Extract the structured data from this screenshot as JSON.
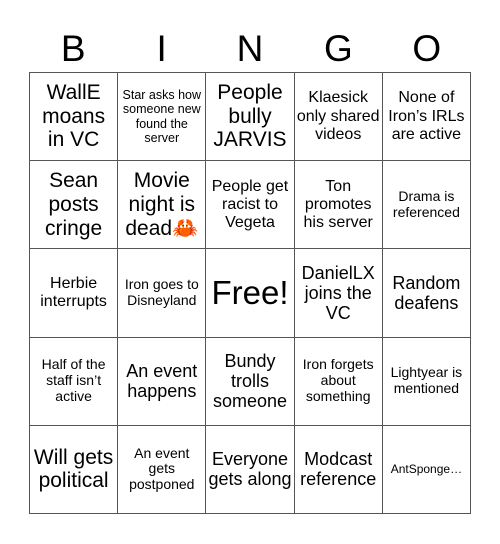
{
  "header": {
    "letters": [
      "B",
      "I",
      "N",
      "G",
      "O"
    ]
  },
  "cells": [
    [
      "WallE moans in VC",
      "Star asks how someone new found the server",
      "People bully JARVIS",
      "Klaesick only shared videos",
      "None of Iron’s IRLs are active"
    ],
    [
      "Sean posts cringe",
      "Movie night is dead🦀",
      "People get racist to Vegeta",
      "Ton promotes his server",
      "Drama is referenced"
    ],
    [
      "Herbie interrupts",
      "Iron goes to Disneyland",
      "Free!",
      "DanielLX joins the VC",
      "Random deafens"
    ],
    [
      "Half of the staff isn’t active",
      "An event happens",
      "Bundy trolls someone",
      "Iron forgets about something",
      "Lightyear is mentioned"
    ],
    [
      "Will gets political",
      "An event gets postponed",
      "Everyone gets along",
      "Modcast reference",
      "AntSponge…"
    ]
  ]
}
